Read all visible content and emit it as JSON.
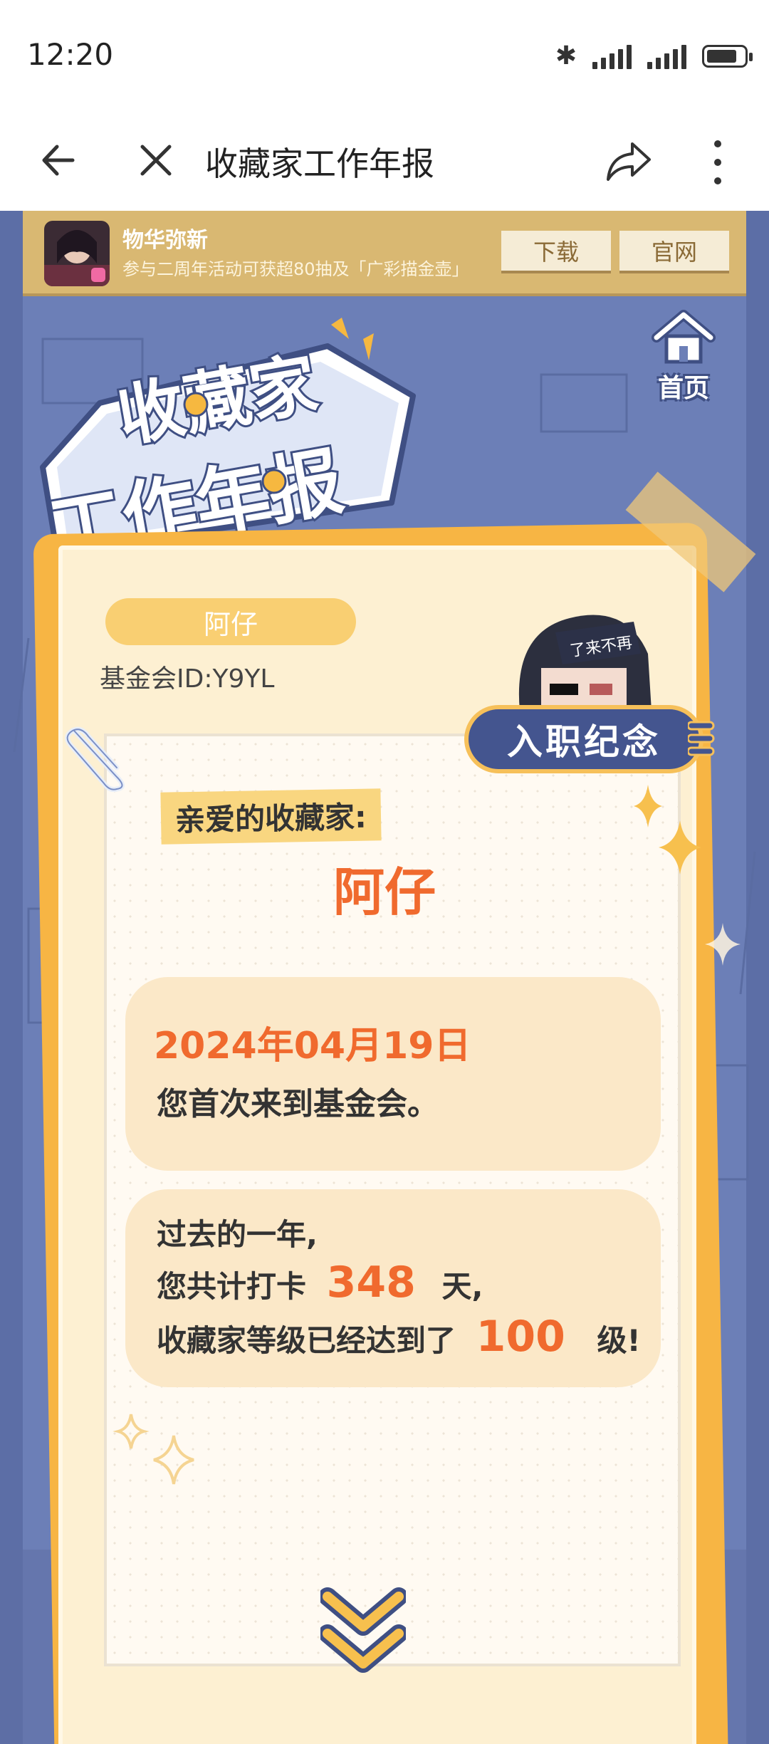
{
  "status_bar": {
    "time": "12:20"
  },
  "nav": {
    "title": "收藏家工作年报"
  },
  "ad": {
    "title": "物华弥新",
    "description": "参与二周年活动可获超80抽及「广彩描金壶」",
    "download_label": "下载",
    "site_label": "官网"
  },
  "home": {
    "label": "首页"
  },
  "logo": {
    "line1": "收藏家",
    "line2": "工作年报"
  },
  "profile": {
    "name": "阿仔",
    "fund_id": "基金会ID:Y9YL"
  },
  "badge": {
    "label": "入职纪念",
    "avatar_tag": "了来不再"
  },
  "letter": {
    "greeting": "亲爱的收藏家:",
    "recipient": "阿仔",
    "date": "2024年04月19日",
    "first_visit": "您首次来到基金会。",
    "past_year": "过去的一年,",
    "checkin_prefix": "您共计打卡",
    "checkin_days": "348",
    "checkin_suffix": "天,",
    "level_prefix": "收藏家等级已经达到了",
    "level_value": "100",
    "level_suffix": "级!"
  },
  "colors": {
    "accent": "#f06a2e",
    "card": "#f7b544",
    "background": "#6c7fb7",
    "badge": "#44558f"
  }
}
